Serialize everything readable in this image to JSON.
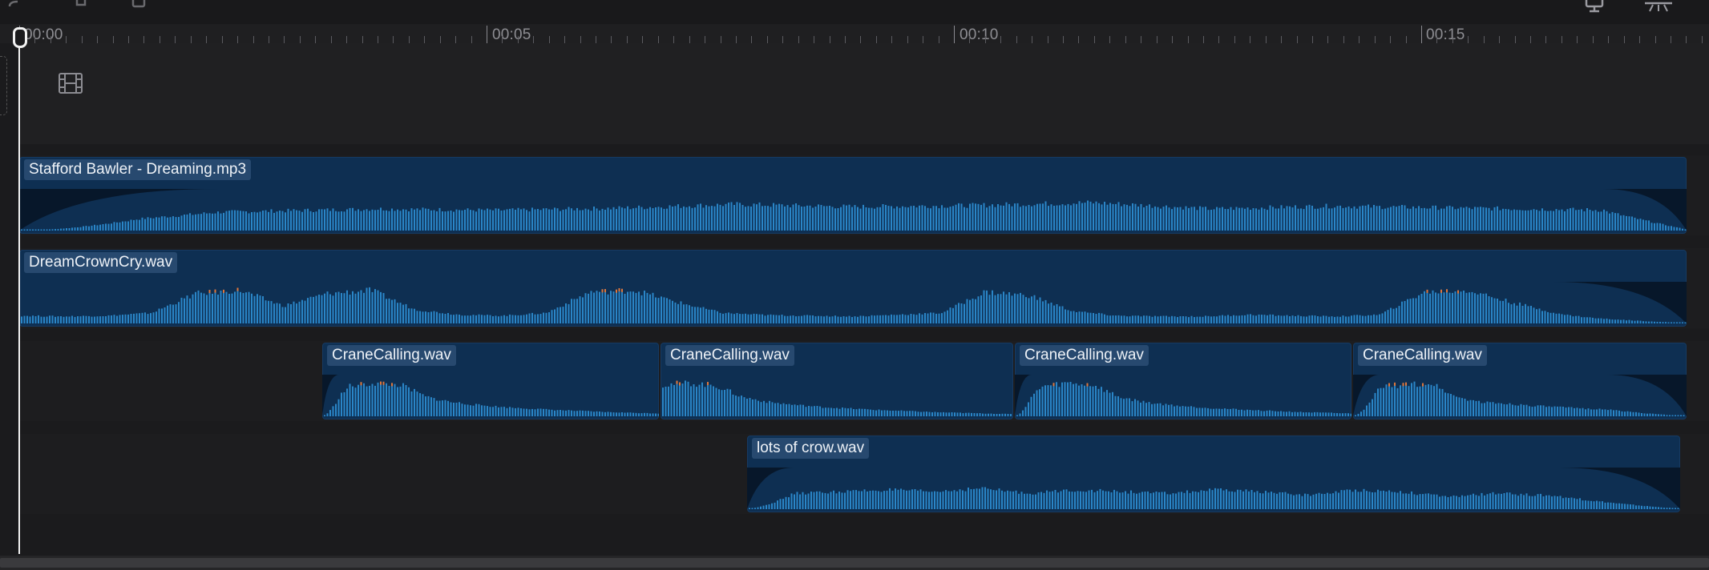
{
  "toolbar": {
    "icons": [
      "undo-icon",
      "split-icon",
      "delete-icon",
      "monitor-icon",
      "presentation-icon"
    ]
  },
  "ruler": {
    "labels": [
      "00:00",
      "00:05",
      "00:10",
      "00:15"
    ]
  },
  "video_track": {
    "icon": "film-icon"
  },
  "audio_tracks": [
    {
      "clips": [
        {
          "label": "Stafford Bawler - Dreaming.mp3"
        }
      ]
    },
    {
      "clips": [
        {
          "label": "DreamCrownCry.wav"
        }
      ]
    },
    {
      "clips": [
        {
          "label": "CraneCalling.wav"
        },
        {
          "label": "CraneCalling.wav"
        },
        {
          "label": "CraneCalling.wav"
        },
        {
          "label": "CraneCalling.wav"
        }
      ]
    },
    {
      "clips": [
        {
          "label": "lots of crow.wav"
        }
      ]
    }
  ],
  "colors": {
    "clip_bg": "#0e2f52",
    "waveform": "#2a86c8",
    "peak": "#e0763a",
    "playhead": "#f2f2f2"
  }
}
